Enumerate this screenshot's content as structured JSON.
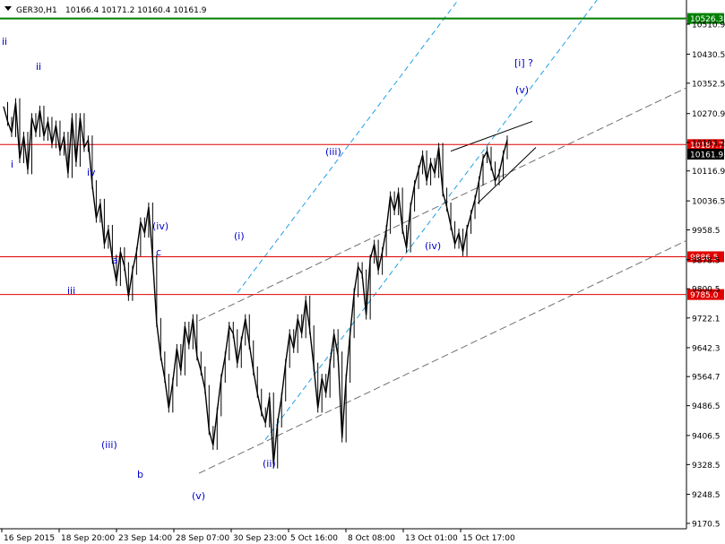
{
  "header": {
    "symbol_tf": "GER30,H1",
    "ohlc": "10166.4 10171.2 10160.4 10161.9"
  },
  "colors": {
    "levels": "#e00000",
    "green_level": "#007f00",
    "channel": "#1e90ff",
    "wave": "#0000cc",
    "candle": "#000000"
  },
  "chart_data": {
    "type": "line",
    "y_ticks": [
      "10510.9",
      "10430.5",
      "10352.5",
      "10270.9",
      "10193.2",
      "10116.9",
      "10036.5",
      "9958.5",
      "9878.5",
      "9800.5",
      "9722.1",
      "9642.3",
      "9564.7",
      "9486.5",
      "9406.5",
      "9328.5",
      "9248.5",
      "9170.5"
    ],
    "y_values": [
      10510.9,
      10430.5,
      10352.5,
      10270.9,
      10193.2,
      10116.9,
      10036.5,
      9958.5,
      9878.5,
      9800.5,
      9722.1,
      9642.3,
      9564.7,
      9486.5,
      9406.5,
      9328.5,
      9248.5,
      9170.5
    ],
    "x_labels": [
      "16 Sep 2015",
      "18 Sep 20:00",
      "23 Sep 14:00",
      "28 Sep 07:00",
      "30 Sep 23:00",
      "5 Oct 16:00",
      "8 Oct 08:00",
      "13 Oct 01:00",
      "15 Oct 17:00"
    ],
    "price_tags": [
      {
        "text": "10526.3",
        "value": 10526.3,
        "kind": "green"
      },
      {
        "text": "10187.7",
        "value": 10187.7,
        "kind": "red"
      },
      {
        "text": "10161.9",
        "value": 10161.9,
        "kind": "current"
      },
      {
        "text": "9886.5",
        "value": 9886.5,
        "kind": "red"
      },
      {
        "text": "9785.0",
        "value": 9785.0,
        "kind": "red"
      }
    ],
    "price_path": [
      [
        0,
        10290
      ],
      [
        1,
        10250
      ],
      [
        2,
        10220
      ],
      [
        3,
        10300
      ],
      [
        4,
        10150
      ],
      [
        5,
        10210
      ],
      [
        6,
        10120
      ],
      [
        7,
        10260
      ],
      [
        8,
        10220
      ],
      [
        9,
        10280
      ],
      [
        10,
        10210
      ],
      [
        11,
        10250
      ],
      [
        12,
        10190
      ],
      [
        13,
        10240
      ],
      [
        14,
        10170
      ],
      [
        15,
        10210
      ],
      [
        16,
        10110
      ],
      [
        17,
        10260
      ],
      [
        18,
        10140
      ],
      [
        19,
        10260
      ],
      [
        20,
        10180
      ],
      [
        21,
        10200
      ],
      [
        22,
        10080
      ],
      [
        23,
        9990
      ],
      [
        24,
        10030
      ],
      [
        25,
        9920
      ],
      [
        26,
        9960
      ],
      [
        27,
        9880
      ],
      [
        28,
        9820
      ],
      [
        29,
        9900
      ],
      [
        30,
        9860
      ],
      [
        31,
        9780
      ],
      [
        32,
        9850
      ],
      [
        33,
        9900
      ],
      [
        34,
        9980
      ],
      [
        35,
        9950
      ],
      [
        36,
        10020
      ],
      [
        37,
        9880
      ],
      [
        38,
        9710
      ],
      [
        39,
        9620
      ],
      [
        40,
        9560
      ],
      [
        41,
        9480
      ],
      [
        42,
        9550
      ],
      [
        43,
        9640
      ],
      [
        44,
        9580
      ],
      [
        45,
        9700
      ],
      [
        46,
        9650
      ],
      [
        47,
        9720
      ],
      [
        48,
        9620
      ],
      [
        49,
        9580
      ],
      [
        50,
        9530
      ],
      [
        51,
        9420
      ],
      [
        52,
        9380
      ],
      [
        53,
        9470
      ],
      [
        54,
        9560
      ],
      [
        55,
        9620
      ],
      [
        56,
        9700
      ],
      [
        57,
        9680
      ],
      [
        58,
        9600
      ],
      [
        59,
        9660
      ],
      [
        60,
        9720
      ],
      [
        61,
        9650
      ],
      [
        62,
        9580
      ],
      [
        63,
        9520
      ],
      [
        64,
        9470
      ],
      [
        65,
        9440
      ],
      [
        66,
        9510
      ],
      [
        67,
        9330
      ],
      [
        68,
        9440
      ],
      [
        69,
        9510
      ],
      [
        70,
        9600
      ],
      [
        71,
        9680
      ],
      [
        72,
        9640
      ],
      [
        73,
        9720
      ],
      [
        74,
        9680
      ],
      [
        75,
        9770
      ],
      [
        76,
        9690
      ],
      [
        77,
        9590
      ],
      [
        78,
        9480
      ],
      [
        79,
        9560
      ],
      [
        80,
        9520
      ],
      [
        81,
        9600
      ],
      [
        82,
        9680
      ],
      [
        83,
        9620
      ],
      [
        84,
        9400
      ],
      [
        85,
        9560
      ],
      [
        86,
        9680
      ],
      [
        87,
        9790
      ],
      [
        88,
        9860
      ],
      [
        89,
        9840
      ],
      [
        90,
        9730
      ],
      [
        91,
        9880
      ],
      [
        92,
        9920
      ],
      [
        93,
        9850
      ],
      [
        94,
        9900
      ],
      [
        95,
        9960
      ],
      [
        96,
        10050
      ],
      [
        97,
        10010
      ],
      [
        98,
        10060
      ],
      [
        99,
        9960
      ],
      [
        100,
        9910
      ],
      [
        101,
        10020
      ],
      [
        102,
        10080
      ],
      [
        103,
        10120
      ],
      [
        104,
        10160
      ],
      [
        105,
        10090
      ],
      [
        106,
        10140
      ],
      [
        107,
        10110
      ],
      [
        108,
        10180
      ],
      [
        109,
        10060
      ],
      [
        110,
        10020
      ],
      [
        111,
        9970
      ],
      [
        112,
        9920
      ],
      [
        113,
        9950
      ],
      [
        114,
        9900
      ],
      [
        115,
        9960
      ],
      [
        116,
        10000
      ],
      [
        117,
        10040
      ],
      [
        118,
        10090
      ],
      [
        119,
        10150
      ],
      [
        120,
        10170
      ],
      [
        121,
        10130
      ],
      [
        122,
        10090
      ],
      [
        123,
        10110
      ],
      [
        124,
        10160
      ],
      [
        125,
        10200
      ]
    ],
    "annotations": [
      "ii",
      "ii",
      "i",
      "iv",
      "iii",
      "a",
      "c",
      "(iv)",
      "(iii)",
      "b",
      "(v)",
      "(i)",
      "(ii)",
      "(iii)",
      "(iv)",
      "[i] ?",
      "(v)"
    ]
  }
}
